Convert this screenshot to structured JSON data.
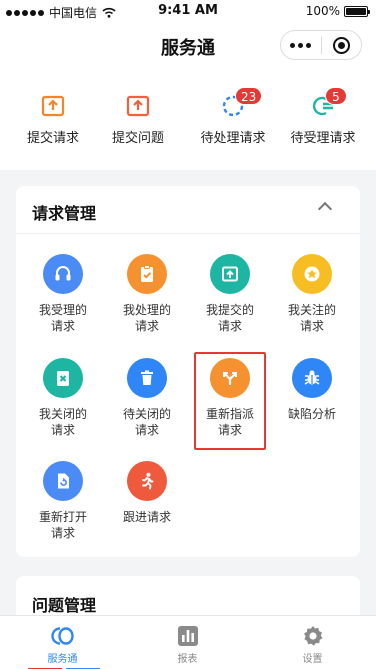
{
  "status_bar": {
    "carrier": "中国电信",
    "time": "9:41 AM",
    "battery": "100%",
    "battery_level": 1.0
  },
  "nav": {
    "title": "服务通"
  },
  "quick_actions": [
    {
      "label": "提交请求",
      "icon": "upload-box-icon",
      "color": "#f2862a"
    },
    {
      "label": "提交问题",
      "icon": "upload-box-icon",
      "color": "#f0613c"
    },
    {
      "label": "待处理请求",
      "icon": "progress-icon",
      "color": "#2f86f6",
      "badge": "23"
    },
    {
      "label": "待受理请求",
      "icon": "list-icon",
      "color": "#1cb6a3",
      "badge": "5"
    }
  ],
  "request_section": {
    "title": "请求管理",
    "items": [
      {
        "label_1": "我受理的",
        "label_2": "请求",
        "icon": "headset-icon",
        "color": "#4a8bf5"
      },
      {
        "label_1": "我处理的",
        "label_2": "请求",
        "icon": "clipboard-check-icon",
        "color": "#f6912f"
      },
      {
        "label_1": "我提交的",
        "label_2": "请求",
        "icon": "upload-icon",
        "color": "#1cb6a3"
      },
      {
        "label_1": "我关注的",
        "label_2": "请求",
        "icon": "star-icon",
        "color": "#f6be23"
      },
      {
        "label_1": "我关闭的",
        "label_2": "请求",
        "icon": "close-doc-icon",
        "color": "#1cb6a3"
      },
      {
        "label_1": "待关闭的",
        "label_2": "请求",
        "icon": "trash-icon",
        "color": "#2f86f6"
      },
      {
        "label_1": "重新指派",
        "label_2": "请求",
        "icon": "reassign-icon",
        "color": "#f6912f"
      },
      {
        "label_1": "缺陷分析",
        "label_2": "",
        "icon": "bug-icon",
        "color": "#2f86f6"
      },
      {
        "label_1": "重新打开",
        "label_2": "请求",
        "icon": "reopen-icon",
        "color": "#4a8bf5"
      },
      {
        "label_1": "跟进请求",
        "label_2": "",
        "icon": "runner-icon",
        "color": "#f05a3c"
      }
    ]
  },
  "issue_section": {
    "title": "问题管理"
  },
  "tabs": [
    {
      "label": "服务通",
      "icon": "service-icon",
      "active": true
    },
    {
      "label": "报表",
      "icon": "chart-icon",
      "active": false
    },
    {
      "label": "设置",
      "icon": "gear-icon",
      "active": false
    }
  ]
}
